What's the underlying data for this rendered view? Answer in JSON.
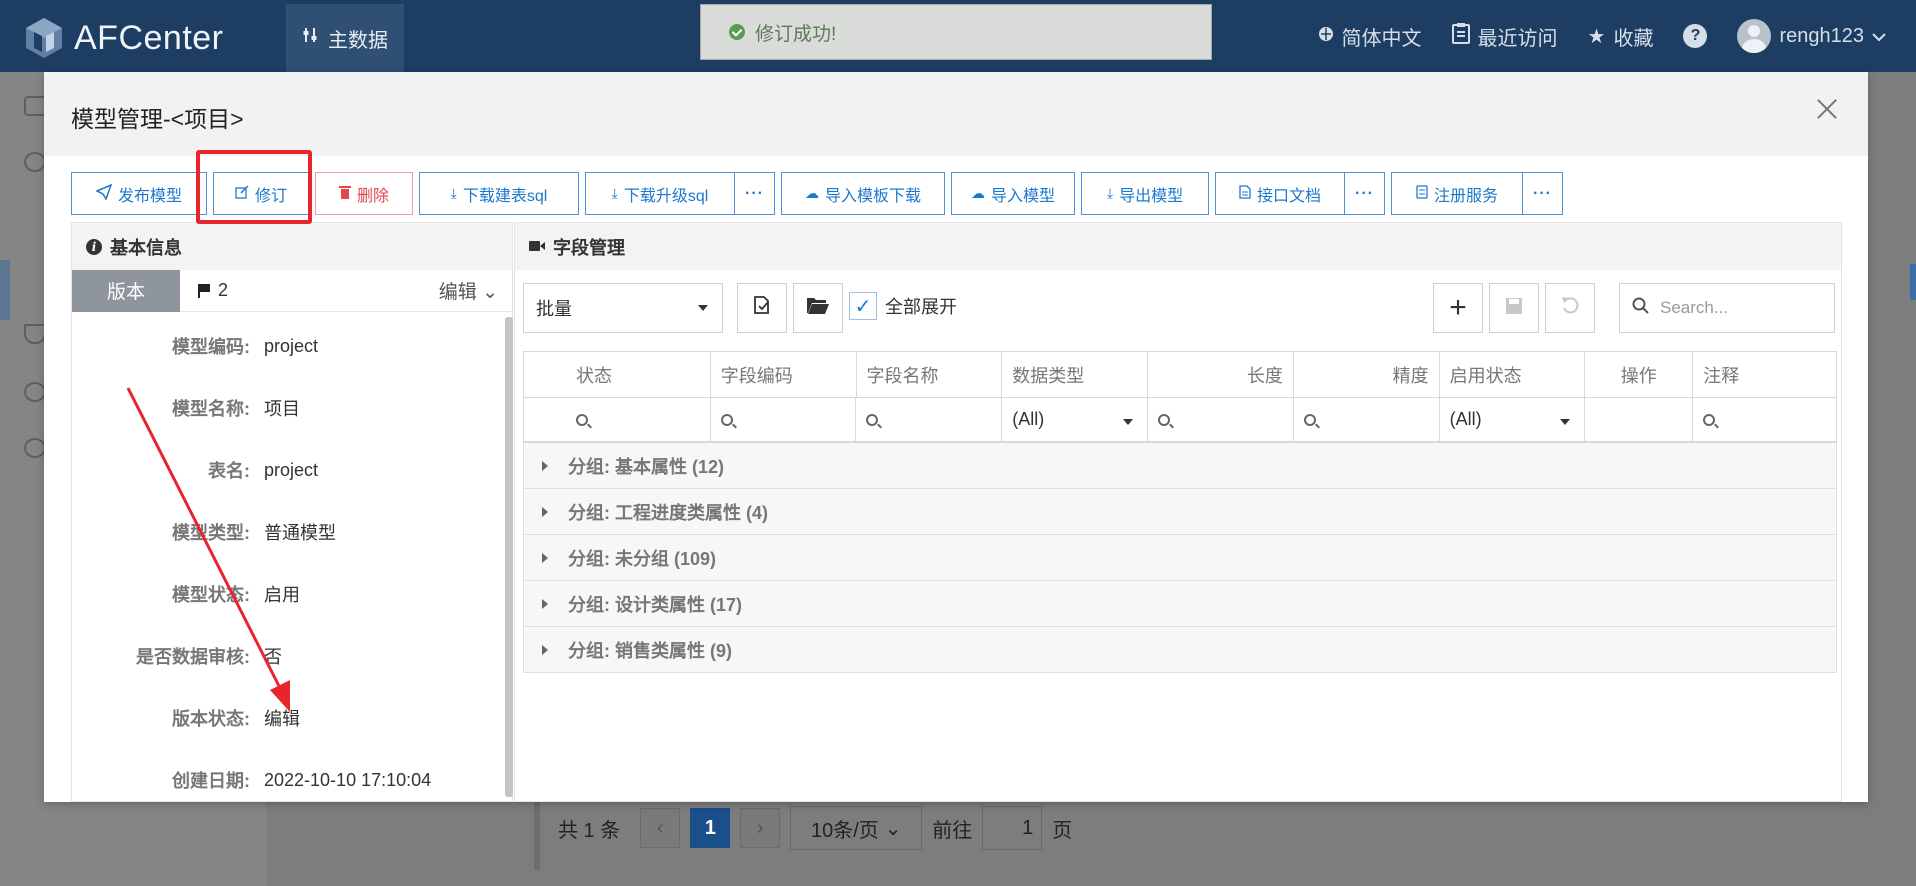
{
  "app": {
    "name": "AFCenter",
    "nav_main": "主数据"
  },
  "topbar": {
    "language": "简体中文",
    "recent": "最近访问",
    "favorites": "收藏",
    "help": "?",
    "user": "rengh123"
  },
  "toast": {
    "message": "修订成功!"
  },
  "modal": {
    "title": "模型管理-<项目>"
  },
  "toolbar": {
    "publish": "发布模型",
    "revise": "修订",
    "delete": "删除",
    "download_create_sql": "下载建表sql",
    "download_upgrade_sql": "下载升级sql",
    "more": "···",
    "import_template": "导入模板下载",
    "import_model": "导入模型",
    "export_model": "导出模型",
    "api_doc": "接口文档",
    "register_service": "注册服务"
  },
  "basic_info": {
    "title": "基本信息",
    "version_tab": "版本",
    "version_num": "2",
    "edit": "编辑",
    "fields": [
      {
        "label": "模型编码:",
        "value": "project"
      },
      {
        "label": "模型名称:",
        "value": "项目"
      },
      {
        "label": "表名:",
        "value": "project"
      },
      {
        "label": "模型类型:",
        "value": "普通模型"
      },
      {
        "label": "模型状态:",
        "value": "启用"
      },
      {
        "label": "是否数据审核:",
        "value": "否"
      },
      {
        "label": "版本状态:",
        "value": "编辑"
      },
      {
        "label": "创建日期:",
        "value": "2022-10-10 17:10:04"
      }
    ]
  },
  "field_mgmt": {
    "title": "字段管理",
    "batch": "批量",
    "expand_all": "全部展开",
    "search_placeholder": "Search...",
    "columns": [
      "状态",
      "字段编码",
      "字段名称",
      "数据类型",
      "长度",
      "精度",
      "启用状态",
      "操作",
      "注释"
    ],
    "filter_all": "(All)",
    "groups": [
      "分组: 基本属性 (12)",
      "分组: 工程进度类属性 (4)",
      "分组: 未分组 (109)",
      "分组: 设计类属性 (17)",
      "分组: 销售类属性 (9)"
    ]
  },
  "pager": {
    "total": "共 1 条",
    "current": "1",
    "page_size": "10条/页",
    "goto_prefix": "前往",
    "goto_value": "1",
    "goto_suffix": "页"
  }
}
